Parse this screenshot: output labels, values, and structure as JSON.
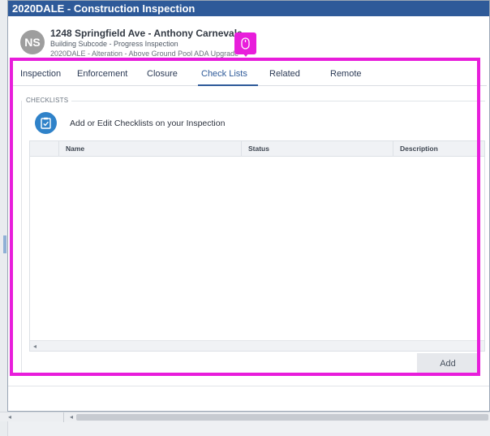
{
  "window": {
    "title": "2020DALE - Construction Inspection"
  },
  "record": {
    "avatar_initials": "NS",
    "title": "1248 Springfield Ave - Anthony Carnevale",
    "subtitle": "Building Subcode - Progress Inspection",
    "detail": "2020DALE - Alteration - Above Ground Pool ADA Upgrade"
  },
  "tabs": [
    {
      "label": "Inspection",
      "active": false
    },
    {
      "label": "Enforcement",
      "active": false
    },
    {
      "label": "Closure",
      "active": false
    },
    {
      "label": "Check Lists",
      "active": true
    },
    {
      "label": "Related",
      "active": false
    },
    {
      "label": "Remote",
      "active": false
    }
  ],
  "checklists": {
    "section_label": "CHECKLISTS",
    "caption": "Add or Edit Checklists on your Inspection",
    "columns": [
      "Name",
      "Status",
      "Description"
    ],
    "rows": [],
    "add_label": "Add"
  },
  "colors": {
    "titlebar": "#2e5a99",
    "accent": "#2f82c9",
    "highlight": "#e81ddb"
  },
  "icons": {
    "checklist": "clipboard-check-icon",
    "cursor": "mouse-icon"
  }
}
